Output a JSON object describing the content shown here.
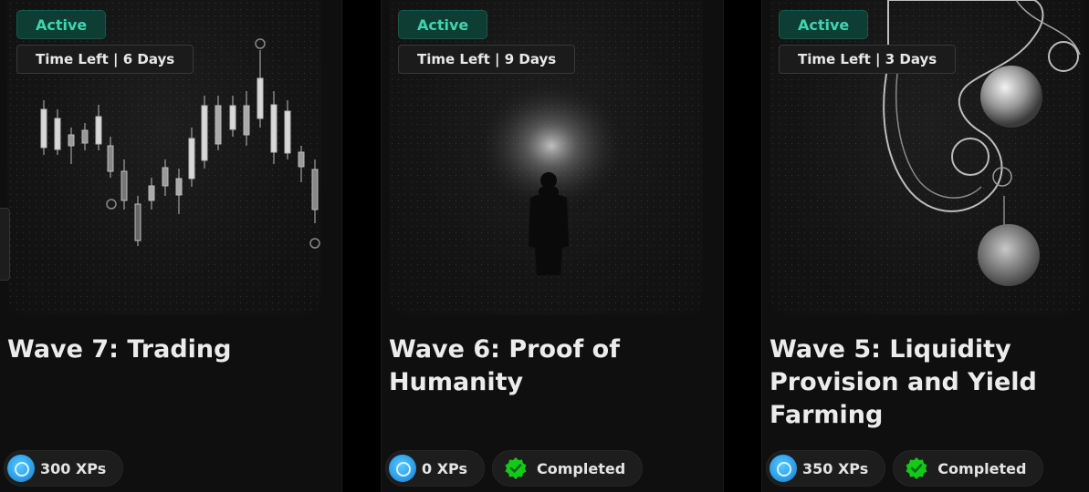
{
  "colors": {
    "accent_green": "#3ed4b0",
    "active_bg": "#0d3d33",
    "completed_green": "#17c917",
    "xp_blue": "#2b9ee8",
    "card_bg": "#0f0f0f"
  },
  "cards": [
    {
      "status_label": "Active",
      "time_left": "Time Left | 6 Days",
      "title": "Wave 7: Trading",
      "xp_label": "300 XPs",
      "image_icon": "candlestick-chart-art"
    },
    {
      "status_label": "Active",
      "time_left": "Time Left | 9 Days",
      "title": "Wave 6: Proof of Humanity",
      "xp_label": "0 XPs",
      "completed_label": "Completed",
      "image_icon": "silhouette-figure-art"
    },
    {
      "status_label": "Active",
      "time_left": "Time Left | 3 Days",
      "title": "Wave 5: Liquidity Provision and Yield Farming",
      "xp_label": "350 XPs",
      "completed_label": "Completed",
      "image_icon": "liquid-bubbles-art"
    }
  ]
}
